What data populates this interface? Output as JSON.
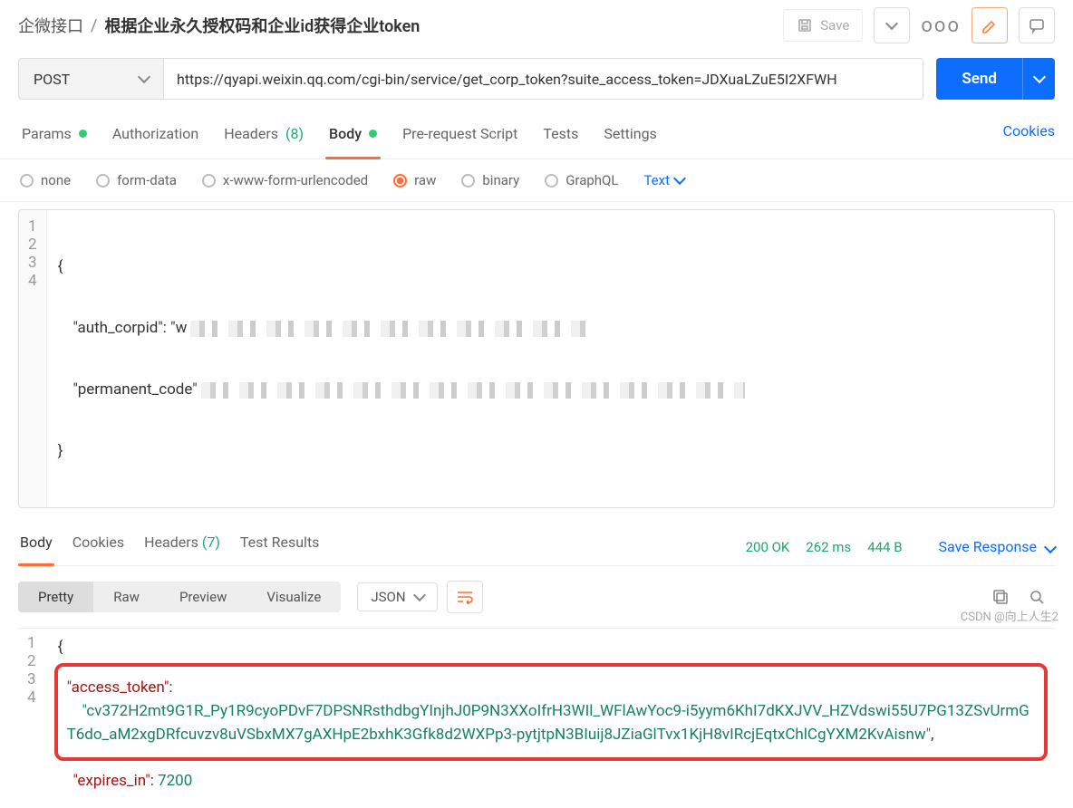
{
  "breadcrumbs": {
    "root": "企微接口",
    "sep": "/",
    "title": "根据企业永久授权码和企业id获得企业token"
  },
  "topActions": {
    "save": "Save"
  },
  "request": {
    "method": "POST",
    "url": "https://qyapi.weixin.qq.com/cgi-bin/service/get_corp_token?suite_access_token=JDXuaLZuE5I2XFWH",
    "sendLabel": "Send"
  },
  "reqTabs": {
    "params": "Params",
    "authorization": "Authorization",
    "headers": "Headers",
    "headersCount": "(8)",
    "body": "Body",
    "prerequest": "Pre-request Script",
    "tests": "Tests",
    "settings": "Settings",
    "cookies": "Cookies"
  },
  "bodyTypes": {
    "none": "none",
    "formdata": "form-data",
    "xwww": "x-www-form-urlencoded",
    "raw": "raw",
    "binary": "binary",
    "graphql": "GraphQL",
    "lang": "Text"
  },
  "requestBody": {
    "lines": [
      "1",
      "2",
      "3",
      "4"
    ],
    "l1": "{",
    "l2_key": "\"auth_corpid\": \"w",
    "l3_key": "\"permanent_code\"",
    "l4": "}"
  },
  "respTabs": {
    "body": "Body",
    "cookies": "Cookies",
    "headers": "Headers",
    "headersCount": "(7)",
    "testResults": "Test Results"
  },
  "respMeta": {
    "status": "200 OK",
    "time": "262 ms",
    "size": "444 B",
    "saveResponse": "Save Response"
  },
  "viewTabs": {
    "pretty": "Pretty",
    "raw": "Raw",
    "preview": "Preview",
    "visualize": "Visualize",
    "format": "JSON"
  },
  "response": {
    "lines": [
      "1",
      "2",
      "",
      "",
      "",
      "3",
      "4"
    ],
    "brace_open": "{",
    "access_token_key": "\"access_token\"",
    "access_token_val": "\"cv372H2mt9G1R_Py1R9cyoPDvF7DPSNRsthdbgYInjhJ0P9N3XXoIfrH3WIl_WFlAwYoc9-i5yym6KhI7dKXJVV_HZVdswi55U7PG13ZSvUrmGT6do_aM2xgDRfcuvzv8uVSbxMX7gAXHpE2bxhK3Gfk8d2WXPp3-pytjtpN3BIuij8JZiaGlTvx1KjH8vIRcjEqtxChlCgYXM2KvAisnw\"",
    "expires_key": "\"expires_in\"",
    "expires_val": "7200"
  },
  "watermark": "CSDN @向上人生2"
}
